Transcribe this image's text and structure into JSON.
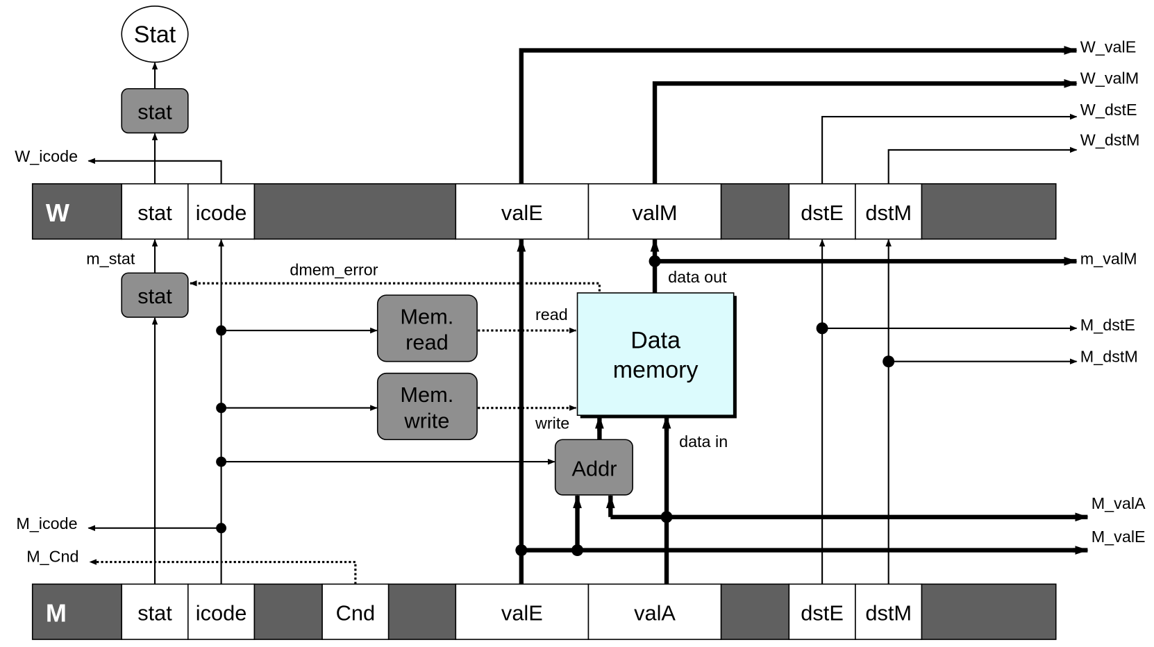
{
  "colors": {
    "register_dark": "#606060",
    "logic_block": "#8f8f8f",
    "data_memory": "#dcfbfd"
  },
  "stat_output": "Stat",
  "w_register": {
    "name": "W",
    "fields": [
      "stat",
      "icode",
      "valE",
      "valM",
      "dstE",
      "dstM"
    ]
  },
  "m_register": {
    "name": "M",
    "fields": [
      "stat",
      "icode",
      "Cnd",
      "valE",
      "valA",
      "dstE",
      "dstM"
    ]
  },
  "blocks": {
    "w_stat": "stat",
    "m_stat": "stat",
    "mem_read": [
      "Mem.",
      "read"
    ],
    "mem_write": [
      "Mem.",
      "write"
    ],
    "data_memory": [
      "Data",
      "memory"
    ],
    "addr": "Addr"
  },
  "signals": {
    "W_icode": "W_icode",
    "W_valE": "W_valE",
    "W_valM": "W_valM",
    "W_dstE": "W_dstE",
    "W_dstM": "W_dstM",
    "m_stat": "m_stat",
    "dmem_error": "dmem_error",
    "m_valM": "m_valM",
    "data_out": "data out",
    "read": "read",
    "write": "write",
    "data_in": "data in",
    "M_dstE": "M_dstE",
    "M_dstM": "M_dstM",
    "M_valA": "M_valA",
    "M_valE": "M_valE",
    "M_icode": "M_icode",
    "M_Cnd": "M_Cnd"
  }
}
